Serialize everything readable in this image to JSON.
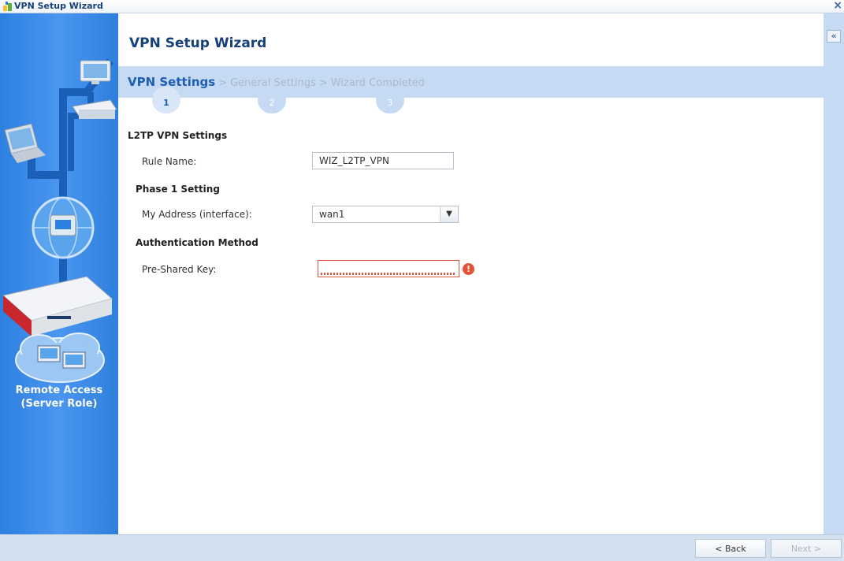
{
  "window": {
    "title": "VPN Setup Wizard",
    "close_label": "×"
  },
  "left_panel": {
    "label_line1": "Remote Access",
    "label_line2": "(Server Role)"
  },
  "main": {
    "title": "VPN Setup Wizard",
    "steps": [
      {
        "label": "VPN Settings",
        "number": "1",
        "active": true
      },
      {
        "label": "General Settings",
        "number": "2",
        "active": false
      },
      {
        "label": "Wizard Completed",
        "number": "3",
        "active": false
      }
    ],
    "step_separator": ">",
    "form": {
      "section_title": "L2TP VPN Settings",
      "rule_name_label": "Rule Name:",
      "rule_name_value": "WIZ_L2TP_VPN",
      "phase1_title": "Phase 1 Setting",
      "my_address_label": "My Address (interface):",
      "my_address_value": "wan1",
      "auth_title": "Authentication Method",
      "psk_label": "Pre-Shared Key:",
      "psk_value": ""
    }
  },
  "sidebar_toggle": {
    "label": "«"
  },
  "footer": {
    "back_label": "< Back",
    "next_label": "Next >"
  },
  "icons": {
    "error": "error-icon",
    "dropdown": "chevron-down-icon",
    "collapse": "collapse-icon"
  },
  "colors": {
    "accent": "#1e5eb5",
    "panel_blue": "#3a8ae6",
    "error": "#e2533a",
    "crumb_bg": "#c6daf3"
  }
}
